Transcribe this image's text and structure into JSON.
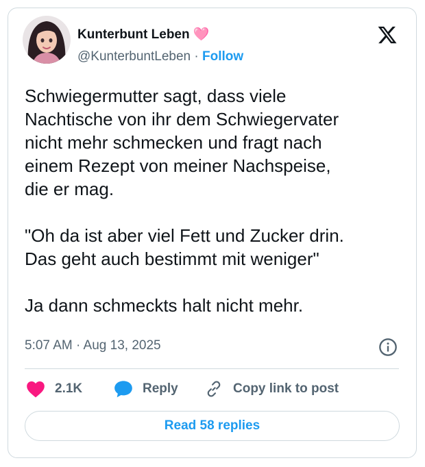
{
  "author": {
    "display_name": "Kunterbunt Leben 🩷",
    "handle": "@KunterbuntLeben",
    "separator": " · ",
    "follow_label": "Follow"
  },
  "icons": {
    "platform": "x-logo-icon",
    "info": "info-icon",
    "like": "heart-icon",
    "reply": "speech-bubble-icon",
    "copy_link": "link-icon"
  },
  "tweet": {
    "text": "Schwiegermutter sagt, dass viele\nNachtische von ihr dem Schwiegervater\nnicht mehr schmecken und fragt nach\neinem Rezept von meiner Nachspeise,\ndie er mag.\n\n\"Oh da ist aber viel Fett und Zucker drin.\nDas geht auch bestimmt mit weniger\"\n\nJa dann schmeckts halt nicht mehr.",
    "timestamp": "5:07 AM · Aug 13, 2025"
  },
  "actions": {
    "like_count": "2.1K",
    "reply_label": "Reply",
    "copy_link_label": "Copy link to post"
  },
  "read_replies_label": "Read 58 replies",
  "colors": {
    "accent": "#1d9bf0",
    "like": "#f91880",
    "text": "#0f1419",
    "secondary": "#536471",
    "border": "#cfd9de"
  }
}
